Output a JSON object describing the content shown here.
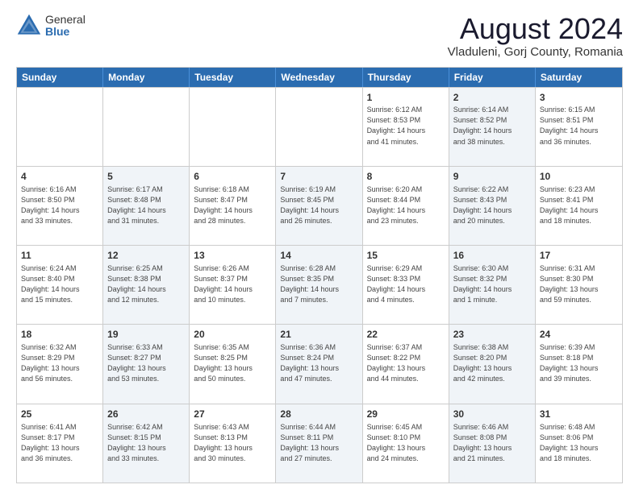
{
  "logo": {
    "general": "General",
    "blue": "Blue"
  },
  "header": {
    "month": "August 2024",
    "location": "Vladuleni, Gorj County, Romania"
  },
  "weekdays": [
    "Sunday",
    "Monday",
    "Tuesday",
    "Wednesday",
    "Thursday",
    "Friday",
    "Saturday"
  ],
  "rows": [
    [
      {
        "day": "",
        "info": ""
      },
      {
        "day": "",
        "info": ""
      },
      {
        "day": "",
        "info": ""
      },
      {
        "day": "",
        "info": ""
      },
      {
        "day": "1",
        "info": "Sunrise: 6:12 AM\nSunset: 8:53 PM\nDaylight: 14 hours\nand 41 minutes."
      },
      {
        "day": "2",
        "info": "Sunrise: 6:14 AM\nSunset: 8:52 PM\nDaylight: 14 hours\nand 38 minutes."
      },
      {
        "day": "3",
        "info": "Sunrise: 6:15 AM\nSunset: 8:51 PM\nDaylight: 14 hours\nand 36 minutes."
      }
    ],
    [
      {
        "day": "4",
        "info": "Sunrise: 6:16 AM\nSunset: 8:50 PM\nDaylight: 14 hours\nand 33 minutes."
      },
      {
        "day": "5",
        "info": "Sunrise: 6:17 AM\nSunset: 8:48 PM\nDaylight: 14 hours\nand 31 minutes."
      },
      {
        "day": "6",
        "info": "Sunrise: 6:18 AM\nSunset: 8:47 PM\nDaylight: 14 hours\nand 28 minutes."
      },
      {
        "day": "7",
        "info": "Sunrise: 6:19 AM\nSunset: 8:45 PM\nDaylight: 14 hours\nand 26 minutes."
      },
      {
        "day": "8",
        "info": "Sunrise: 6:20 AM\nSunset: 8:44 PM\nDaylight: 14 hours\nand 23 minutes."
      },
      {
        "day": "9",
        "info": "Sunrise: 6:22 AM\nSunset: 8:43 PM\nDaylight: 14 hours\nand 20 minutes."
      },
      {
        "day": "10",
        "info": "Sunrise: 6:23 AM\nSunset: 8:41 PM\nDaylight: 14 hours\nand 18 minutes."
      }
    ],
    [
      {
        "day": "11",
        "info": "Sunrise: 6:24 AM\nSunset: 8:40 PM\nDaylight: 14 hours\nand 15 minutes."
      },
      {
        "day": "12",
        "info": "Sunrise: 6:25 AM\nSunset: 8:38 PM\nDaylight: 14 hours\nand 12 minutes."
      },
      {
        "day": "13",
        "info": "Sunrise: 6:26 AM\nSunset: 8:37 PM\nDaylight: 14 hours\nand 10 minutes."
      },
      {
        "day": "14",
        "info": "Sunrise: 6:28 AM\nSunset: 8:35 PM\nDaylight: 14 hours\nand 7 minutes."
      },
      {
        "day": "15",
        "info": "Sunrise: 6:29 AM\nSunset: 8:33 PM\nDaylight: 14 hours\nand 4 minutes."
      },
      {
        "day": "16",
        "info": "Sunrise: 6:30 AM\nSunset: 8:32 PM\nDaylight: 14 hours\nand 1 minute."
      },
      {
        "day": "17",
        "info": "Sunrise: 6:31 AM\nSunset: 8:30 PM\nDaylight: 13 hours\nand 59 minutes."
      }
    ],
    [
      {
        "day": "18",
        "info": "Sunrise: 6:32 AM\nSunset: 8:29 PM\nDaylight: 13 hours\nand 56 minutes."
      },
      {
        "day": "19",
        "info": "Sunrise: 6:33 AM\nSunset: 8:27 PM\nDaylight: 13 hours\nand 53 minutes."
      },
      {
        "day": "20",
        "info": "Sunrise: 6:35 AM\nSunset: 8:25 PM\nDaylight: 13 hours\nand 50 minutes."
      },
      {
        "day": "21",
        "info": "Sunrise: 6:36 AM\nSunset: 8:24 PM\nDaylight: 13 hours\nand 47 minutes."
      },
      {
        "day": "22",
        "info": "Sunrise: 6:37 AM\nSunset: 8:22 PM\nDaylight: 13 hours\nand 44 minutes."
      },
      {
        "day": "23",
        "info": "Sunrise: 6:38 AM\nSunset: 8:20 PM\nDaylight: 13 hours\nand 42 minutes."
      },
      {
        "day": "24",
        "info": "Sunrise: 6:39 AM\nSunset: 8:18 PM\nDaylight: 13 hours\nand 39 minutes."
      }
    ],
    [
      {
        "day": "25",
        "info": "Sunrise: 6:41 AM\nSunset: 8:17 PM\nDaylight: 13 hours\nand 36 minutes."
      },
      {
        "day": "26",
        "info": "Sunrise: 6:42 AM\nSunset: 8:15 PM\nDaylight: 13 hours\nand 33 minutes."
      },
      {
        "day": "27",
        "info": "Sunrise: 6:43 AM\nSunset: 8:13 PM\nDaylight: 13 hours\nand 30 minutes."
      },
      {
        "day": "28",
        "info": "Sunrise: 6:44 AM\nSunset: 8:11 PM\nDaylight: 13 hours\nand 27 minutes."
      },
      {
        "day": "29",
        "info": "Sunrise: 6:45 AM\nSunset: 8:10 PM\nDaylight: 13 hours\nand 24 minutes."
      },
      {
        "day": "30",
        "info": "Sunrise: 6:46 AM\nSunset: 8:08 PM\nDaylight: 13 hours\nand 21 minutes."
      },
      {
        "day": "31",
        "info": "Sunrise: 6:48 AM\nSunset: 8:06 PM\nDaylight: 13 hours\nand 18 minutes."
      }
    ]
  ],
  "shading": {
    "row0": [
      false,
      false,
      false,
      false,
      false,
      true,
      false
    ],
    "row1": [
      false,
      true,
      false,
      true,
      false,
      true,
      false
    ],
    "row2": [
      false,
      true,
      false,
      true,
      false,
      true,
      false
    ],
    "row3": [
      false,
      true,
      false,
      true,
      false,
      true,
      false
    ],
    "row4": [
      false,
      true,
      false,
      true,
      false,
      true,
      false
    ]
  }
}
